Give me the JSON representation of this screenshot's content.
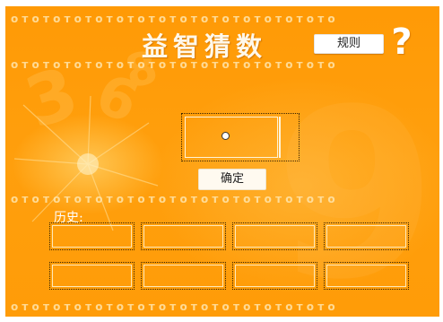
{
  "title": "益智猜数",
  "rules_button_label": "规则",
  "help_icon_glyph": "?",
  "guess_value": "",
  "confirm_button_label": "确定",
  "history_label": "历史:",
  "history": [
    "",
    "",
    "",
    "",
    "",
    "",
    "",
    ""
  ],
  "colors": {
    "background": "#ff9c08",
    "decoration": "#ffd88a",
    "button_fill": "#ffffff"
  }
}
